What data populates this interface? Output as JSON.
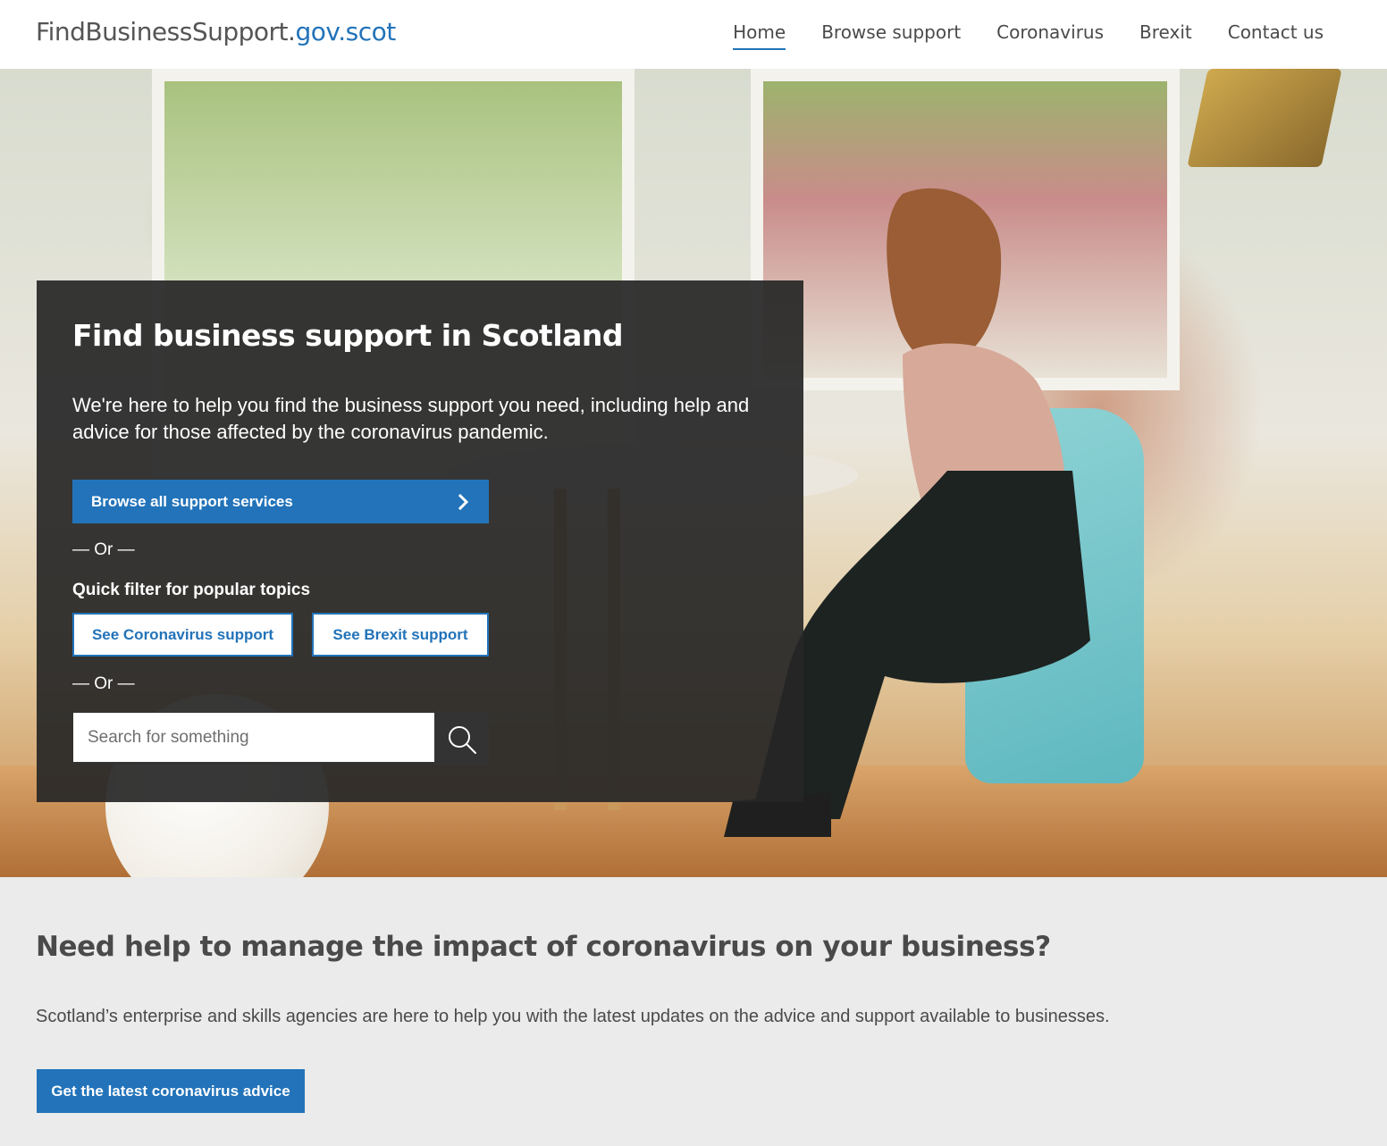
{
  "header": {
    "logo_main": "FindBusinessSupport.",
    "logo_domain": "gov.scot",
    "nav": [
      {
        "label": "Home",
        "active": true
      },
      {
        "label": "Browse support",
        "active": false
      },
      {
        "label": "Coronavirus",
        "active": false
      },
      {
        "label": "Brexit",
        "active": false
      },
      {
        "label": "Contact us",
        "active": false
      }
    ]
  },
  "hero": {
    "title": "Find business support in Scotland",
    "intro": "We're here to help you find the business support you need, including help and advice for those affected by the coronavirus pandemic.",
    "browse_button": "Browse all support services",
    "browse_icon": "chevron-right-icon",
    "or_separator": "— Or —",
    "quick_filter_label": "Quick filter for popular topics",
    "filters": [
      {
        "label": "See Coronavirus support"
      },
      {
        "label": "See Brexit support"
      }
    ],
    "search": {
      "placeholder": "Search for something",
      "value": "",
      "icon": "search-icon"
    }
  },
  "lower": {
    "title": "Need help to manage the impact of coronavirus on your business?",
    "text": "Scotland’s enterprise and skills agencies are here to help you with the latest updates on the advice and support available to businesses.",
    "button": "Get the latest coronavirus advice"
  },
  "colors": {
    "accent": "#2273b9",
    "panel": "#262626",
    "page_bg": "#ebebeb"
  }
}
